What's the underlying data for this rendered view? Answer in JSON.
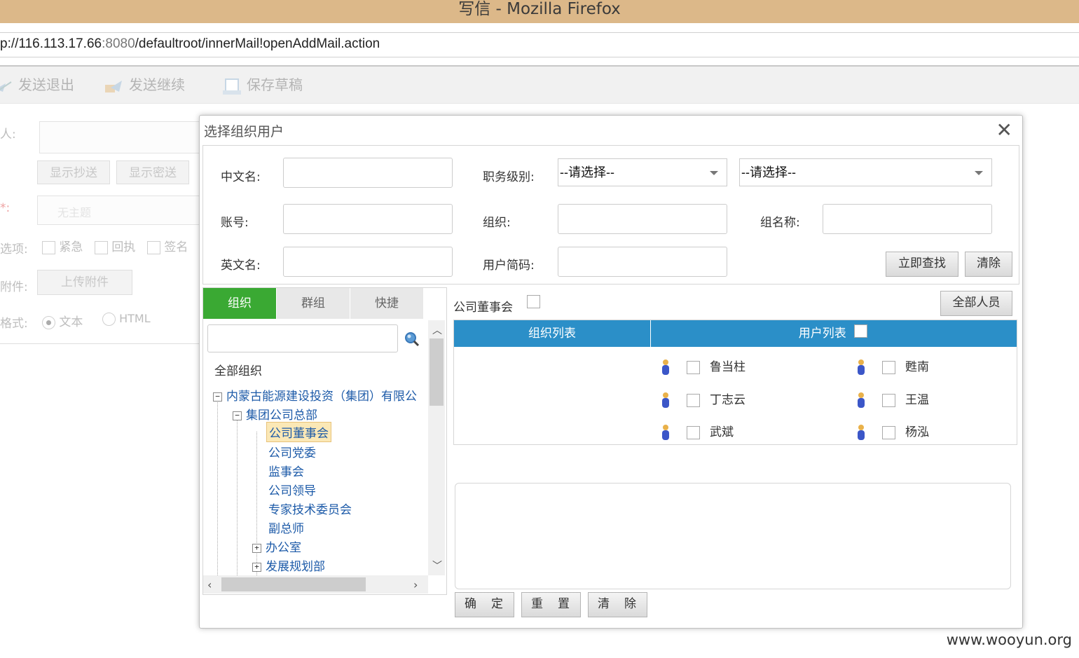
{
  "window": {
    "title": "写信 - Mozilla Firefox"
  },
  "urlbar": {
    "scheme": "p://",
    "host": "116.113.17.66",
    "port": ":8080",
    "path": "/defaultroot/innerMail!openAddMail.action"
  },
  "toolbar": {
    "send_exit": "发送退出",
    "send_continue": "发送继续",
    "save_draft": "保存草稿"
  },
  "mail_form": {
    "recipient_label": "人:",
    "show_cc": "显示抄送",
    "show_bcc": "显示密送",
    "subject_label": "*:",
    "subject_placeholder": "无主题",
    "options_label": "选项:",
    "opt_urgent": "紧急",
    "opt_receipt": "回执",
    "opt_sign": "签名",
    "attach_label": "附件:",
    "upload_button": "上传附件",
    "format_label": "格式:",
    "format_text": "文本",
    "format_html": "HTML"
  },
  "dialog": {
    "title": "选择组织用户",
    "close_symbol": "✕",
    "search": {
      "chinese_name_label": "中文名:",
      "job_level_label": "职务级别:",
      "job_level_value": "--请选择--",
      "second_select_value": "--请选择--",
      "account_label": "账号:",
      "org_label": "组织:",
      "group_name_label": "组名称:",
      "english_name_label": "英文名:",
      "user_code_label": "用户简码:",
      "search_button": "立即查找",
      "clear_button": "清除"
    },
    "tabs": [
      {
        "label": "组织"
      },
      {
        "label": "群组"
      },
      {
        "label": "快捷"
      }
    ],
    "tree": {
      "root_label": "全部组织",
      "nodes": [
        {
          "label": "内蒙古能源建设投资（集团）有限公",
          "toggle": "−"
        },
        {
          "label": "集团公司总部",
          "toggle": "−"
        },
        {
          "label": "公司董事会",
          "selected": true
        },
        {
          "label": "公司党委"
        },
        {
          "label": "监事会"
        },
        {
          "label": "公司领导"
        },
        {
          "label": "专家技术委员会"
        },
        {
          "label": "副总师"
        },
        {
          "label": "办公室",
          "toggle": "+"
        },
        {
          "label": "发展规划部",
          "toggle": "+"
        }
      ]
    },
    "current_org": "公司董事会",
    "all_people_button": "全部人员",
    "grid": {
      "org_list_header": "组织列表",
      "user_list_header": "用户列表",
      "users": [
        "鲁当柱",
        "甦南",
        "丁志云",
        "王温",
        "武斌",
        "杨泓"
      ]
    },
    "footer": {
      "confirm": "确　定",
      "reset": "重　置",
      "clear": "清　除"
    }
  },
  "watermark": "www.wooyun.org",
  "colors": {
    "titlebar": "#dcb889",
    "tab_active": "#3aa933",
    "grid_header": "#2b8fc8",
    "tree_link": "#1c5aa8"
  }
}
